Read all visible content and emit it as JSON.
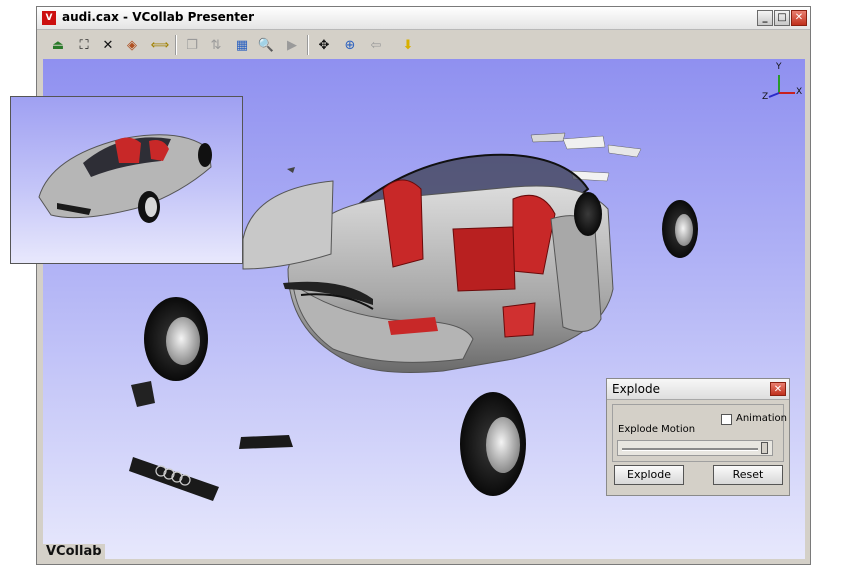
{
  "window": {
    "title": "audi.cax - VCollab Presenter",
    "app_icon_letter": "V",
    "minimize_glyph": "_",
    "maximize_glyph": "□",
    "close_glyph": "✕"
  },
  "toolbar": {
    "buttons": [
      {
        "name": "home-view-icon",
        "glyph": "⏏"
      },
      {
        "name": "fit-view-icon",
        "glyph": "⛶"
      },
      {
        "name": "explode-icon",
        "glyph": "✕"
      },
      {
        "name": "cube-view-icon",
        "glyph": "◈"
      },
      {
        "name": "section-icon",
        "glyph": "⟺"
      },
      {
        "name": "copy-icon",
        "glyph": "❐"
      },
      {
        "name": "compare-icon",
        "glyph": "⇅"
      },
      {
        "name": "contour-icon",
        "glyph": "▦"
      },
      {
        "name": "zoom-icon",
        "glyph": "🔍"
      },
      {
        "name": "play-icon",
        "glyph": "▶"
      },
      {
        "name": "pan-icon",
        "glyph": "✥"
      },
      {
        "name": "zoom-window-icon",
        "glyph": "⊕"
      },
      {
        "name": "back-icon",
        "glyph": "⇦"
      },
      {
        "name": "pick-icon",
        "glyph": "⬇"
      }
    ]
  },
  "viewport": {
    "logo": "VCollab",
    "axis_labels": {
      "x": "X",
      "y": "Y",
      "z": "Z"
    },
    "colors": {
      "background_top": "#8f90f0",
      "background_bottom": "#e7e8fc",
      "car_body": "#b8b8b8",
      "seats": "#c82828"
    }
  },
  "explode_panel": {
    "title": "Explode",
    "close_glyph": "✕",
    "animation_label": "Animation",
    "animation_checked": false,
    "motion_label": "Explode Motion",
    "slider_value": 1.0,
    "explode_button": "Explode",
    "reset_button": "Reset"
  }
}
